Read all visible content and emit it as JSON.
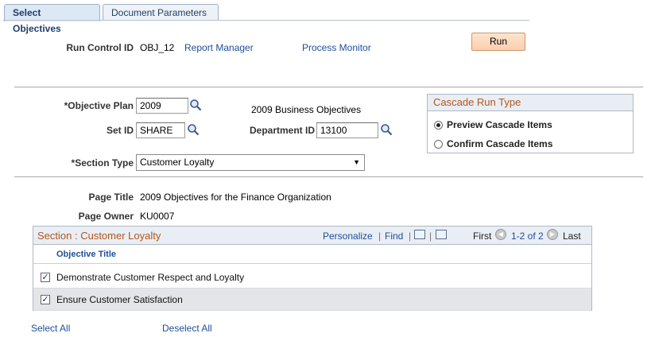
{
  "tabs": {
    "active": "Select Objectives",
    "inactive": "Document Parameters"
  },
  "header": {
    "run_control_label": "Run Control ID",
    "run_control_value": "OBJ_12",
    "report_manager": "Report Manager",
    "process_monitor": "Process Monitor",
    "run_button": "Run"
  },
  "form": {
    "objective_plan_label": "*Objective Plan",
    "objective_plan_value": "2009",
    "objective_plan_desc": "2009 Business Objectives",
    "setid_label": "Set ID",
    "setid_value": "SHARE",
    "dept_label": "Department ID",
    "dept_value": "13100",
    "section_type_label": "*Section Type",
    "section_type_value": "Customer Loyalty"
  },
  "cascade": {
    "title": "Cascade Run Type",
    "options": [
      "Preview Cascade Items",
      "Confirm Cascade Items"
    ],
    "selected": "Preview Cascade Items"
  },
  "page": {
    "title_label": "Page Title",
    "title_value": "2009 Objectives for the Finance Organization",
    "owner_label": "Page Owner",
    "owner_value": "KU0007"
  },
  "grid": {
    "title": "Section : Customer Loyalty",
    "personalize": "Personalize",
    "find": "Find",
    "first": "First",
    "range": "1-2 of 2",
    "last": "Last",
    "column": "Objective Title",
    "rows": [
      {
        "title": "Demonstrate Customer Respect and Loyalty",
        "checked": true
      },
      {
        "title": "Ensure Customer Satisfaction",
        "checked": true
      }
    ]
  },
  "footer": {
    "select_all": "Select All",
    "deselect_all": "Deselect All"
  }
}
